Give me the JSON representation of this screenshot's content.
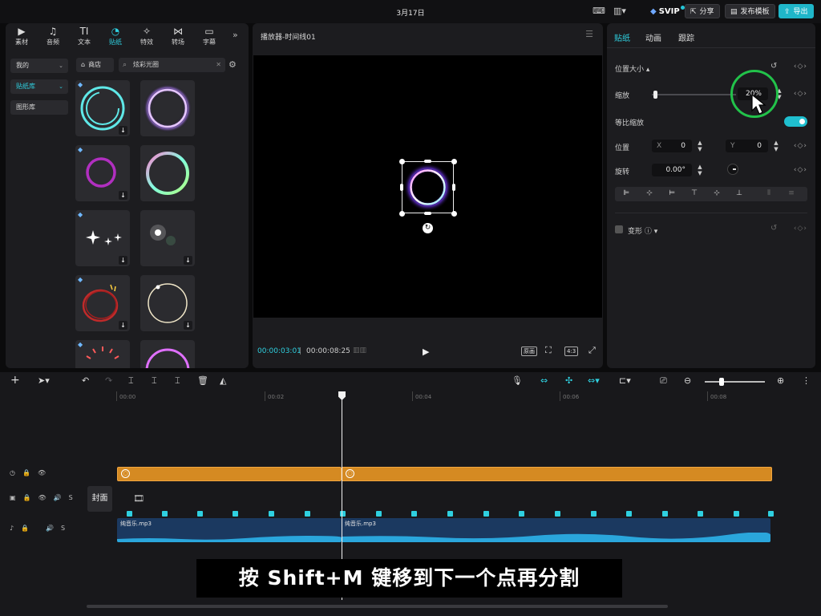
{
  "topbar": {
    "date": "3月17日",
    "svip_label": "SVIP",
    "share_label": "分享",
    "publish_label": "发布模板",
    "export_label": "导出"
  },
  "left_panel": {
    "categories": [
      {
        "label": "素材",
        "icon": "▶"
      },
      {
        "label": "音频",
        "icon": "♫"
      },
      {
        "label": "文本",
        "icon": "TI"
      },
      {
        "label": "贴纸",
        "icon": "◔"
      },
      {
        "label": "特效",
        "icon": "✧"
      },
      {
        "label": "转场",
        "icon": "⋈"
      },
      {
        "label": "字幕",
        "icon": "▭"
      }
    ],
    "active_category": "贴纸",
    "sidebar": [
      {
        "label": "我的",
        "chevron": "⌄"
      },
      {
        "label": "贴纸库",
        "chevron": "⌄"
      },
      {
        "label": "图形库",
        "chevron": ""
      }
    ],
    "store_label": "商店",
    "search_value": "炫彩光圈"
  },
  "player": {
    "title": "播放器-时间线01",
    "current_time": "00:00:03:01",
    "total_time": "00:00:08:25",
    "btn_original": "原画",
    "btn_ratio": "4:3"
  },
  "inspector": {
    "tabs": [
      "贴纸",
      "动画",
      "跟踪"
    ],
    "section_title": "位置大小 ▴",
    "scale_label": "缩放",
    "scale_value": "20%",
    "uniform_label": "等比缩放",
    "position_label": "位置",
    "pos_x_prefix": "X",
    "pos_x": "0",
    "pos_y_prefix": "Y",
    "pos_y": "0",
    "rotate_label": "旋转",
    "rotate_value": "0.00°",
    "transform_label": "变形 ⓘ ▾"
  },
  "timeline": {
    "ruler_labels": [
      "00:00",
      "00:02",
      "00:04",
      "00:06",
      "00:08"
    ],
    "cover_label": "封面",
    "audio_clip_names": [
      "纯音乐.mp3",
      "纯音乐.mp3"
    ],
    "subtitle": "按  Shift+M  键移到下一个点再分割"
  },
  "colors": {
    "accent": "#2fd0e0",
    "sticker_clip": "#d58a22",
    "audio_clip": "#1b3960",
    "highlight_ring": "#22c24a"
  }
}
